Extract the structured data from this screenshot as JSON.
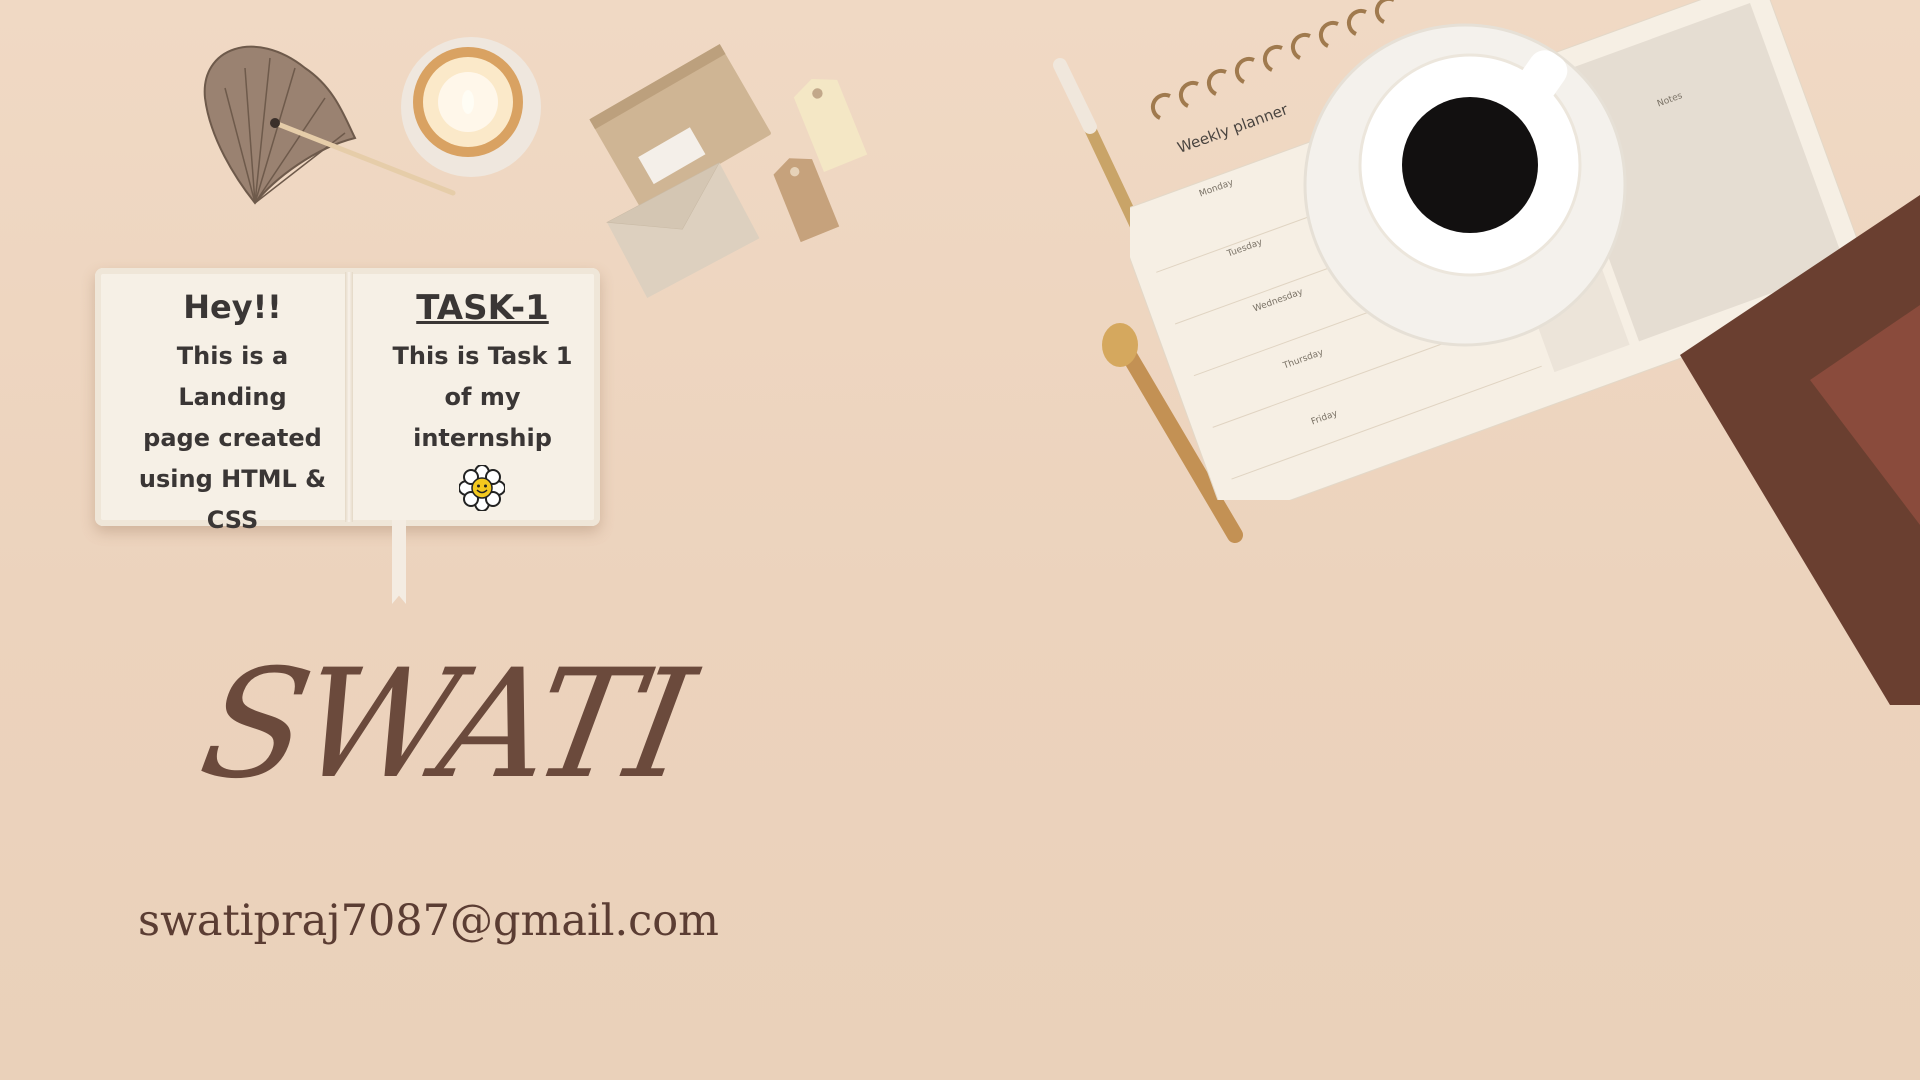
{
  "notebook": {
    "left_heading": "Hey!!",
    "left_lines": [
      "This is a Landing",
      "page created",
      "using HTML &",
      "CSS"
    ],
    "right_heading": "TASK-1",
    "right_lines": [
      "This is Task 1",
      "of my",
      "internship"
    ]
  },
  "planner": {
    "title": "Weekly planner",
    "days": [
      "Monday",
      "Tuesday",
      "Wednesday",
      "Thursday",
      "Friday"
    ],
    "notes_label": "Notes"
  },
  "signature": "SWATI",
  "email": "swatipraj7087@gmail.com",
  "colors": {
    "background": "#ecd3bd",
    "text_dark": "#3a3635",
    "signature": "#6b4a3c"
  }
}
